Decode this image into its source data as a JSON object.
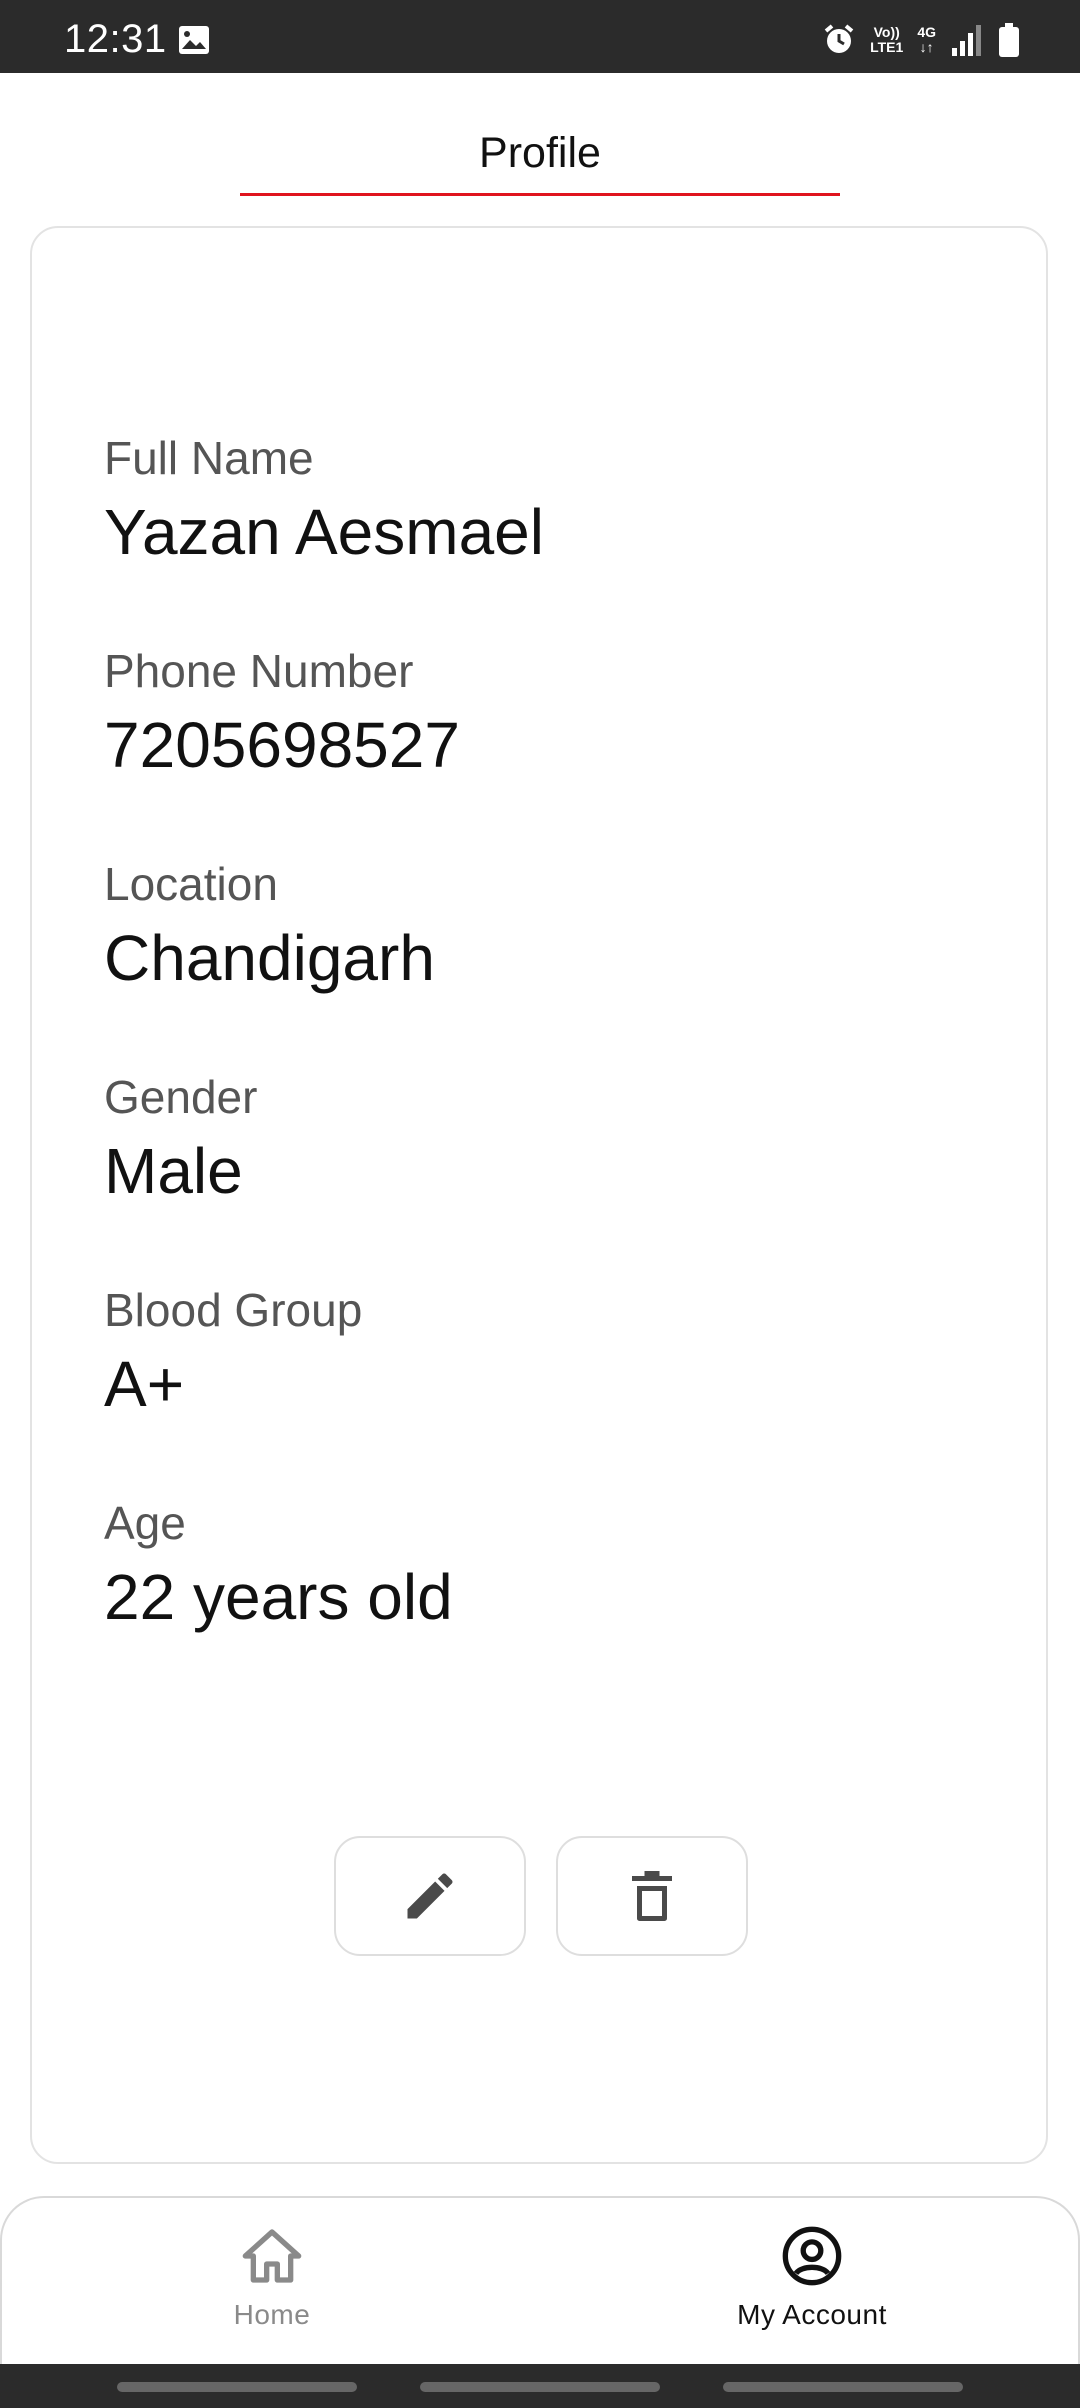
{
  "status_bar": {
    "time": "12:31",
    "icons": [
      "image-icon",
      "alarm-icon",
      "volte-icon",
      "4g-icon",
      "signal-icon",
      "battery-icon"
    ],
    "volte_line1": "Vo))",
    "volte_line2": "LTE1",
    "net_type": "4G"
  },
  "header": {
    "title": "Profile",
    "underline_color": "#e0141e"
  },
  "profile": {
    "fields": [
      {
        "label": "Full Name",
        "value": "Yazan Aesmael"
      },
      {
        "label": "Phone Number",
        "value": "7205698527"
      },
      {
        "label": "Location",
        "value": "Chandigarh"
      },
      {
        "label": "Gender",
        "value": "Male"
      },
      {
        "label": "Blood Group",
        "value": "A+"
      },
      {
        "label": "Age",
        "value": "22 years old"
      }
    ],
    "actions": [
      {
        "icon": "pencil-icon",
        "purpose": "edit"
      },
      {
        "icon": "trash-icon",
        "purpose": "delete"
      }
    ]
  },
  "bottom_nav": {
    "items": [
      {
        "label": "Home",
        "icon": "home-icon",
        "active": false
      },
      {
        "label": "My Account",
        "icon": "account-circle-icon",
        "active": true
      }
    ]
  }
}
